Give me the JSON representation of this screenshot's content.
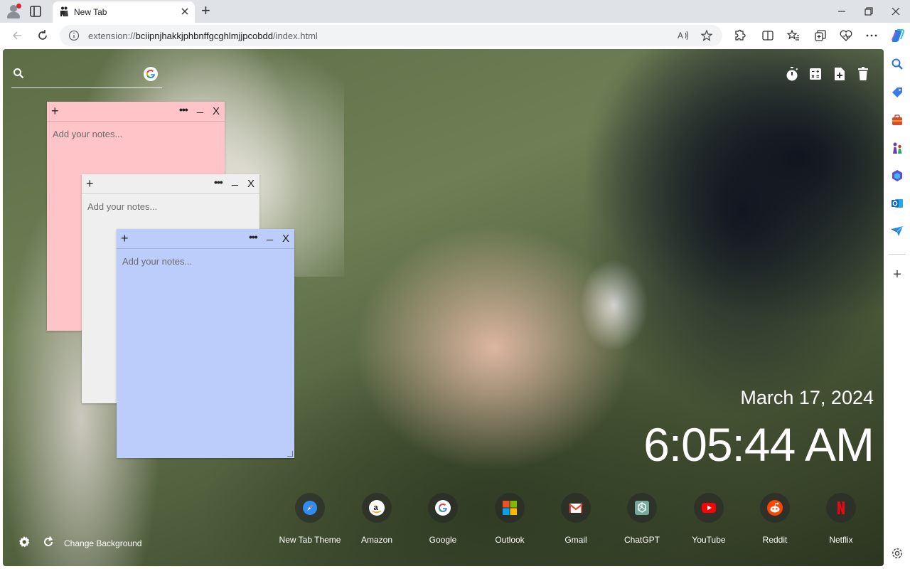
{
  "browser": {
    "tab_title": "New Tab",
    "url_prefix": "extension://",
    "url_host": "bciipnjhakkjphbnffgcghlmjjpcobdd",
    "url_path": "/index.html",
    "new_tab_symbol": "+",
    "sidebar_add_symbol": "+"
  },
  "search": {
    "icon": "search-icon",
    "engine_icon": "google-icon"
  },
  "top_tools": [
    "timer-icon",
    "calculator-icon",
    "add-note-icon",
    "trash-icon"
  ],
  "notes": [
    {
      "color": "#ffc4c8",
      "placeholder": "Add your notes...",
      "plus": "+",
      "more": "•••",
      "minimize": "_",
      "close": "X"
    },
    {
      "color": "#efefef",
      "placeholder": "Add your notes...",
      "plus": "+",
      "more": "•••",
      "minimize": "_",
      "close": "X"
    },
    {
      "color": "#bccdfc",
      "placeholder": "Add your notes...",
      "plus": "+",
      "more": "•••",
      "minimize": "_",
      "close": "X"
    }
  ],
  "clock": {
    "date": "March 17, 2024",
    "time": "6:05:44 AM"
  },
  "shortcuts": [
    {
      "label": "New Tab Theme",
      "icon": "compass-icon"
    },
    {
      "label": "Amazon",
      "icon": "amazon-icon"
    },
    {
      "label": "Google",
      "icon": "google-icon"
    },
    {
      "label": "Outlook",
      "icon": "microsoft-icon"
    },
    {
      "label": "Gmail",
      "icon": "gmail-icon"
    },
    {
      "label": "ChatGPT",
      "icon": "chatgpt-icon"
    },
    {
      "label": "YouTube",
      "icon": "youtube-icon"
    },
    {
      "label": "Reddit",
      "icon": "reddit-icon"
    },
    {
      "label": "Netflix",
      "icon": "netflix-icon"
    }
  ],
  "footer": {
    "change_background": "Change Background"
  }
}
